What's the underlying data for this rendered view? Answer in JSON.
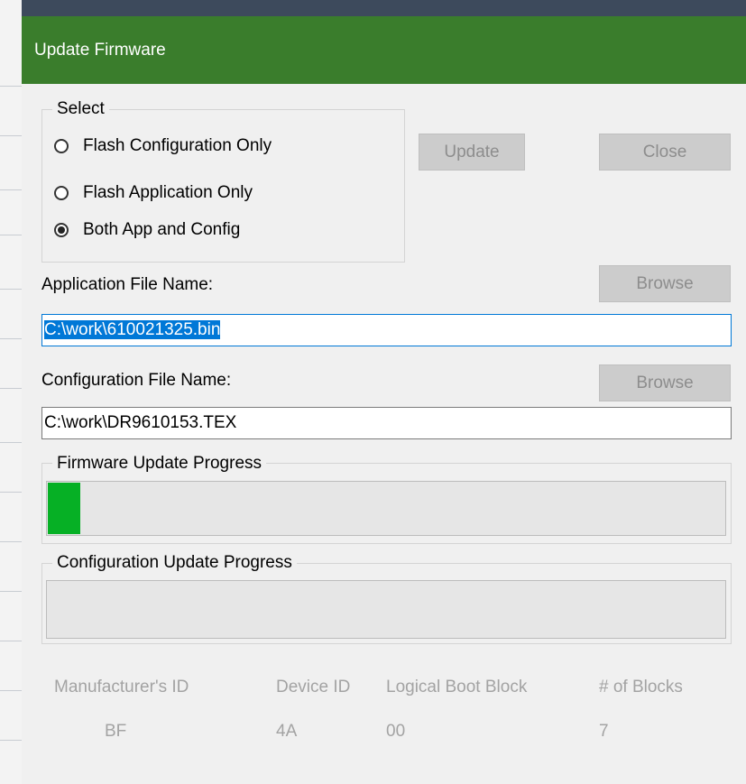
{
  "window": {
    "title": "Update Firmware"
  },
  "select_group": {
    "legend": "Select",
    "options": [
      {
        "label": "Flash Configuration Only",
        "checked": false
      },
      {
        "label": "Flash Application Only",
        "checked": false
      },
      {
        "label": "Both App and Config",
        "checked": true
      }
    ]
  },
  "buttons": {
    "update": "Update",
    "close": "Close",
    "browse_app": "Browse",
    "browse_config": "Browse"
  },
  "application_file": {
    "label": "Application File Name:",
    "value": "C:\\work\\610021325.bin"
  },
  "configuration_file": {
    "label": "Configuration File Name:",
    "value": "C:\\work\\DR9610153.TEX"
  },
  "firmware_progress": {
    "legend": "Firmware Update Progress",
    "value_percent": 5
  },
  "config_progress": {
    "legend": "Configuration Update Progress",
    "value_percent": 0
  },
  "device_info": {
    "manufacturer_id_label": "Manufacturer's ID",
    "manufacturer_id_value": "BF",
    "device_id_label": "Device ID",
    "device_id_value": "4A",
    "logical_boot_block_label": "Logical Boot Block",
    "logical_boot_block_value": "00",
    "num_blocks_label": "# of Blocks",
    "num_blocks_value": "7"
  },
  "colors": {
    "titlebar": "#3a7d2c",
    "progress_fill": "#06b025",
    "selection": "#0078d7"
  }
}
